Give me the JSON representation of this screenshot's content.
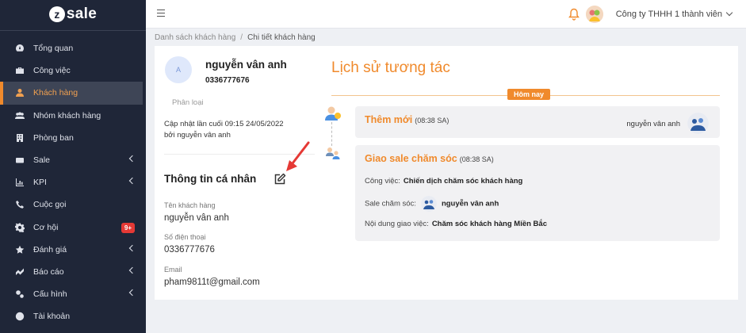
{
  "brand": {
    "logo_mark": "z",
    "logo_text": "sale"
  },
  "sidebar": {
    "items": [
      {
        "label": "Tổng quan",
        "icon": "dashboard-icon"
      },
      {
        "label": "Công việc",
        "icon": "briefcase-icon"
      },
      {
        "label": "Khách hàng",
        "icon": "user-icon",
        "active": true
      },
      {
        "label": "Nhóm khách hàng",
        "icon": "users-icon"
      },
      {
        "label": "Phòng ban",
        "icon": "building-icon"
      },
      {
        "label": "Sale",
        "icon": "dollar-icon",
        "expandable": true
      },
      {
        "label": "KPI",
        "icon": "chart-icon",
        "expandable": true
      },
      {
        "label": "Cuộc gọi",
        "icon": "phone-icon"
      },
      {
        "label": "Cơ hội",
        "icon": "gear-icon",
        "badge": "9+"
      },
      {
        "label": "Đánh giá",
        "icon": "star-icon",
        "expandable": true
      },
      {
        "label": "Báo cáo",
        "icon": "report-icon",
        "expandable": true
      },
      {
        "label": "Cấu hình",
        "icon": "settings-icon",
        "expandable": true
      },
      {
        "label": "Tài khoản",
        "icon": "account-icon"
      }
    ]
  },
  "topbar": {
    "company": "Công ty THHH 1 thành viên"
  },
  "breadcrumb": {
    "parent": "Danh sách khách hàng",
    "separator": "/",
    "current": "Chi tiết khách hàng"
  },
  "customer": {
    "avatar_letter": "A",
    "name": "nguyễn vân anh",
    "phone": "0336777676",
    "classification_label": "Phân loại",
    "updated_line1": "Cập nhật lần cuối 09:15 24/05/2022",
    "updated_line2": "bởi nguyễn vân anh"
  },
  "personal_info": {
    "title": "Thông tin cá nhân",
    "fields": [
      {
        "label": "Tên khách hàng",
        "value": "nguyễn vân anh"
      },
      {
        "label": "Số điện thoại",
        "value": "0336777676"
      },
      {
        "label": "Email",
        "value": "pham9811t@gmail.com"
      }
    ]
  },
  "history": {
    "title": "Lịch sử tương tác",
    "date_label": "Hôm nay",
    "events": [
      {
        "title": "Thêm mới",
        "time": "(08:38 SA)",
        "user": "nguyễn vân anh"
      },
      {
        "title": "Giao sale chăm sóc",
        "time": "(08:38 SA)",
        "task_label": "Công việc:",
        "task_value": "Chiến dịch chăm sóc khách hàng",
        "sale_label": "Sale chăm sóc:",
        "sale_value": "nguyễn vân anh",
        "content_label": "Nội dung giao việc:",
        "content_value": "Chăm sóc khách hàng Miền Bắc"
      }
    ]
  },
  "colors": {
    "accent": "#f08a2c",
    "sidebar_bg": "#1f2638",
    "badge": "#e53935",
    "arrow": "#e53935"
  }
}
